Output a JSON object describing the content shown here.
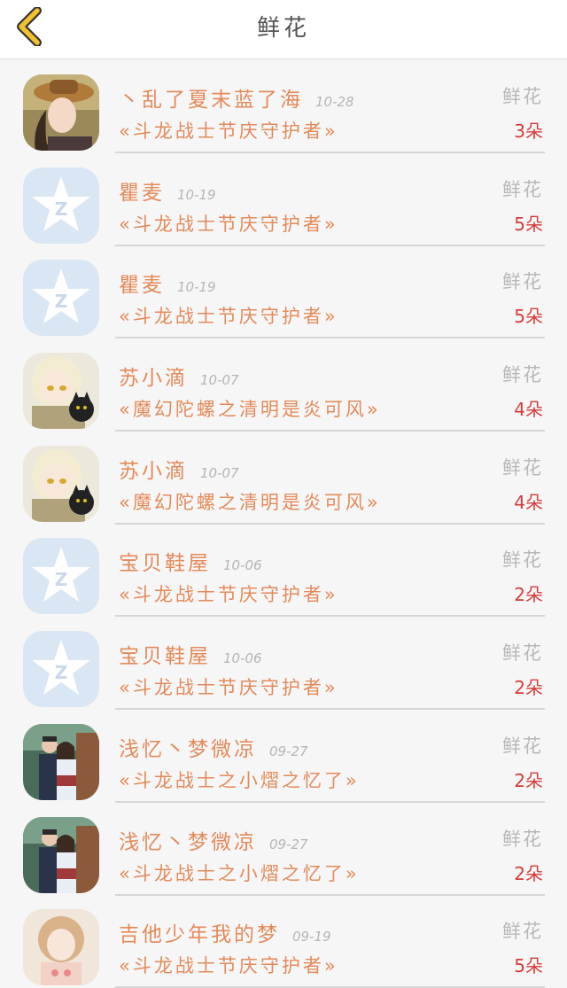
{
  "header": {
    "title": "鲜花",
    "back_icon": "chevron-left-icon",
    "back_color": "#f2c12e"
  },
  "list": {
    "items": [
      {
        "name": "丶乱了夏末蓝了海",
        "date": "10-28",
        "gift": "«斗龙战士节庆守护者»",
        "label": "鲜花",
        "count": "3朵",
        "avatar": "girl-hat"
      },
      {
        "name": "瞿麦",
        "date": "10-19",
        "gift": "«斗龙战士节庆守护者»",
        "label": "鲜花",
        "count": "5朵",
        "avatar": "default-star"
      },
      {
        "name": "瞿麦",
        "date": "10-19",
        "gift": "«斗龙战士节庆守护者»",
        "label": "鲜花",
        "count": "5朵",
        "avatar": "default-star"
      },
      {
        "name": "苏小滴",
        "date": "10-07",
        "gift": "«魔幻陀螺之清明是炎可风»",
        "label": "鲜花",
        "count": "4朵",
        "avatar": "anime-cat"
      },
      {
        "name": "苏小滴",
        "date": "10-07",
        "gift": "«魔幻陀螺之清明是炎可风»",
        "label": "鲜花",
        "count": "4朵",
        "avatar": "anime-cat"
      },
      {
        "name": "宝贝鞋屋",
        "date": "10-06",
        "gift": "«斗龙战士节庆守护者»",
        "label": "鲜花",
        "count": "2朵",
        "avatar": "default-star"
      },
      {
        "name": "宝贝鞋屋",
        "date": "10-06",
        "gift": "«斗龙战士节庆守护者»",
        "label": "鲜花",
        "count": "2朵",
        "avatar": "default-star"
      },
      {
        "name": "浅忆丶梦微凉",
        "date": "09-27",
        "gift": "«斗龙战士之小熠之忆了»",
        "label": "鲜花",
        "count": "2朵",
        "avatar": "couple"
      },
      {
        "name": "浅忆丶梦微凉",
        "date": "09-27",
        "gift": "«斗龙战士之小熠之忆了»",
        "label": "鲜花",
        "count": "2朵",
        "avatar": "couple"
      },
      {
        "name": "吉他少年我的梦",
        "date": "09-19",
        "gift": "«斗龙战士节庆守护者»",
        "label": "鲜花",
        "count": "5朵",
        "avatar": "anime-girl"
      }
    ]
  },
  "colors": {
    "name": "#e48a5a",
    "gift": "#e48a5a",
    "count": "#d63b3b",
    "label": "#b8b8b8",
    "date": "#b5b5b5",
    "default_avatar_bg": "#d9e6f3"
  }
}
